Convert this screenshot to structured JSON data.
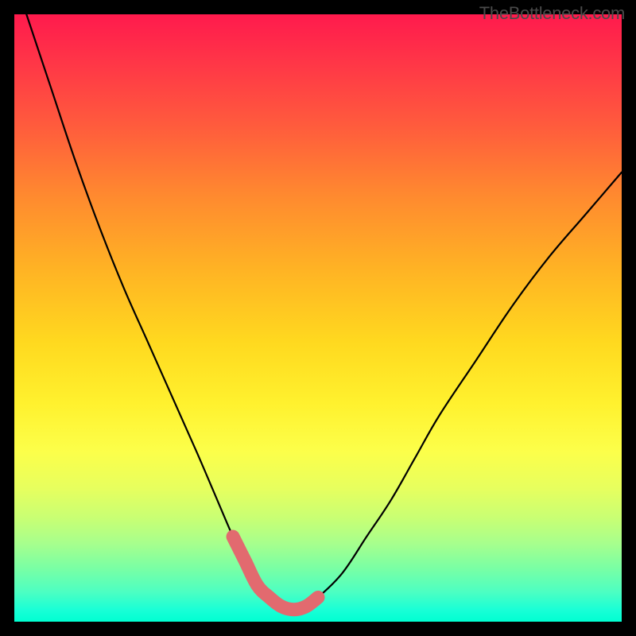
{
  "watermark": "TheBottleneck.com",
  "chart_data": {
    "type": "line",
    "title": "",
    "xlabel": "",
    "ylabel": "",
    "xlim": [
      0,
      100
    ],
    "ylim": [
      0,
      100
    ],
    "series": [
      {
        "name": "bottleneck-curve",
        "x": [
          2,
          6,
          10,
          14,
          18,
          22,
          26,
          30,
          33,
          36,
          38,
          40,
          42,
          44,
          46,
          48,
          50,
          54,
          58,
          62,
          66,
          70,
          76,
          82,
          88,
          94,
          100
        ],
        "values": [
          100,
          88,
          76,
          65,
          55,
          46,
          37,
          28,
          21,
          14,
          10,
          6,
          4,
          2.5,
          2,
          2.5,
          4,
          8,
          14,
          20,
          27,
          34,
          43,
          52,
          60,
          67,
          74
        ]
      }
    ],
    "highlight": {
      "name": "optimal-zone",
      "x": [
        36,
        38,
        40,
        42,
        44,
        46,
        48,
        50
      ],
      "values": [
        14,
        10,
        6,
        4,
        2.5,
        2,
        2.5,
        4
      ]
    },
    "gradient_stops": [
      {
        "pos": 0,
        "color": "#ff1a4d"
      },
      {
        "pos": 50,
        "color": "#ffe025"
      },
      {
        "pos": 85,
        "color": "#c0ff6a"
      },
      {
        "pos": 100,
        "color": "#00ffd2"
      }
    ]
  }
}
